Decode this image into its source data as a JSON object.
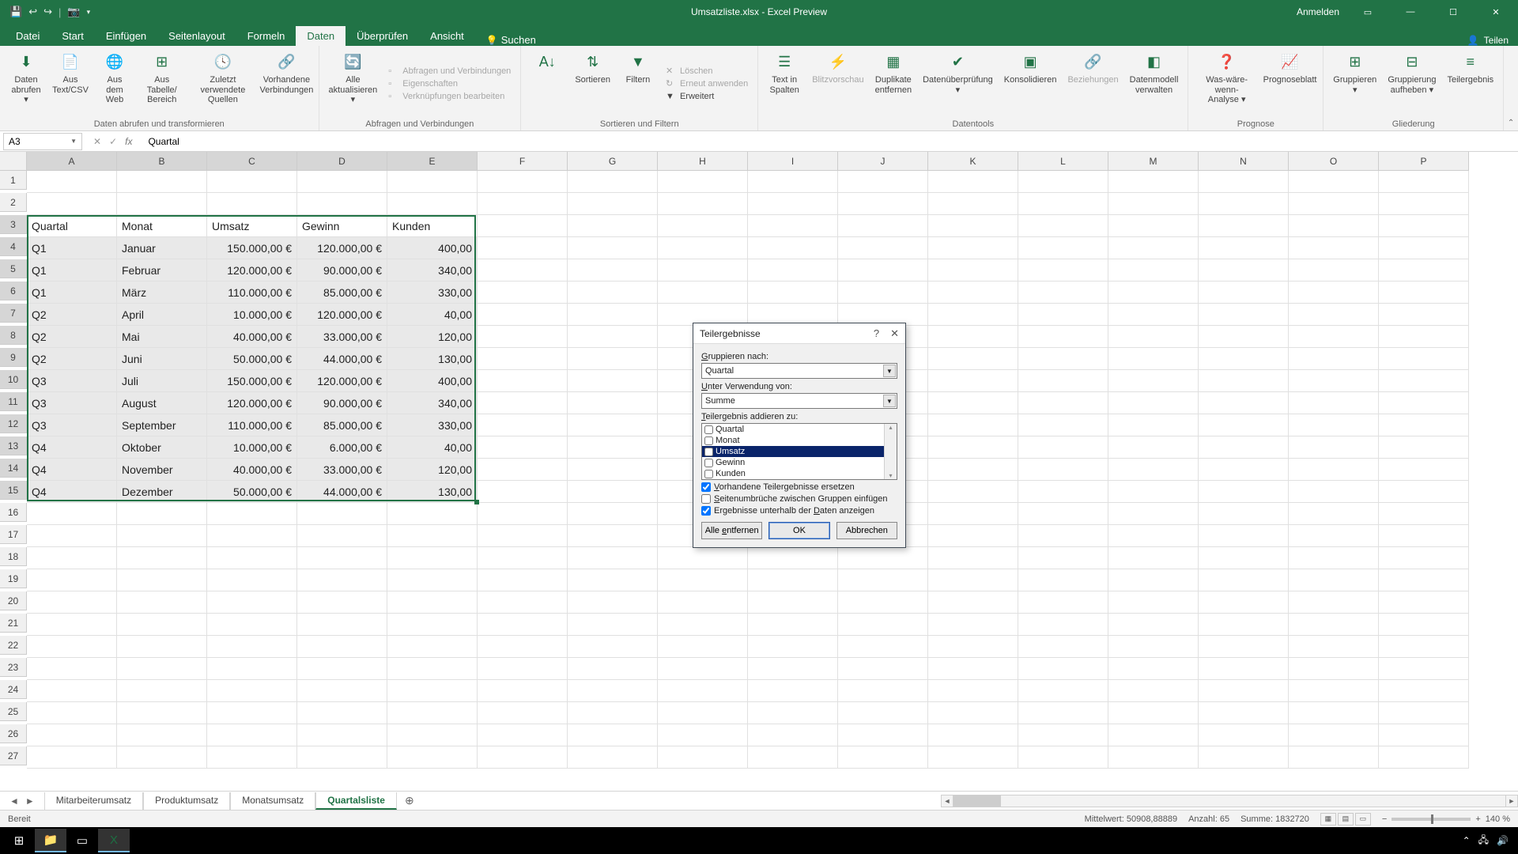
{
  "titlebar": {
    "title": "Umsatzliste.xlsx - Excel Preview",
    "anmelden": "Anmelden"
  },
  "menu": {
    "tabs": [
      "Datei",
      "Start",
      "Einfügen",
      "Seitenlayout",
      "Formeln",
      "Daten",
      "Überprüfen",
      "Ansicht"
    ],
    "active": 5,
    "search": "Suchen",
    "share": "Teilen"
  },
  "ribbon": {
    "g1": {
      "items": [
        "Daten\nabrufen ▾",
        "Aus\nText/CSV",
        "Aus dem\nWeb",
        "Aus Tabelle/\nBereich",
        "Zuletzt verwendete\nQuellen",
        "Vorhandene\nVerbindungen"
      ],
      "label": "Daten abrufen und transformieren"
    },
    "g2": {
      "btn": "Alle\naktualisieren ▾",
      "list": [
        "Abfragen und Verbindungen",
        "Eigenschaften",
        "Verknüpfungen bearbeiten"
      ],
      "label": "Abfragen und Verbindungen"
    },
    "g3": {
      "items": [
        "Sortieren",
        "Filtern"
      ],
      "list": [
        "Löschen",
        "Erneut anwenden",
        "Erweitert"
      ],
      "label": "Sortieren und Filtern"
    },
    "g4": {
      "items": [
        "Text in\nSpalten",
        "Blitzvorschau",
        "Duplikate\nentfernen",
        "Datenüberprüfung\n▾",
        "Konsolidieren",
        "Beziehungen",
        "Datenmodell\nverwalten"
      ],
      "label": "Datentools"
    },
    "g5": {
      "items": [
        "Was-wäre-wenn-\nAnalyse ▾",
        "Prognoseblatt"
      ],
      "label": "Prognose"
    },
    "g6": {
      "items": [
        "Gruppieren\n▾",
        "Gruppierung\naufheben ▾",
        "Teilergebnis"
      ],
      "label": "Gliederung"
    }
  },
  "namebox": "A3",
  "formula": "Quartal",
  "columns": [
    "A",
    "B",
    "C",
    "D",
    "E",
    "F",
    "G",
    "H",
    "I",
    "J",
    "K",
    "L",
    "M",
    "N",
    "O",
    "P"
  ],
  "rows": [
    1,
    2,
    3,
    4,
    5,
    6,
    7,
    8,
    9,
    10,
    11,
    12,
    13,
    14,
    15,
    16,
    17,
    18,
    19,
    20,
    21,
    22,
    23,
    24,
    25,
    26,
    27
  ],
  "headers": [
    "Quartal",
    "Monat",
    "Umsatz",
    "Gewinn",
    "Kunden"
  ],
  "data": [
    [
      "Q1",
      "Januar",
      "150.000,00 €",
      "120.000,00 €",
      "400,00"
    ],
    [
      "Q1",
      "Februar",
      "120.000,00 €",
      "90.000,00 €",
      "340,00"
    ],
    [
      "Q1",
      "März",
      "110.000,00 €",
      "85.000,00 €",
      "330,00"
    ],
    [
      "Q2",
      "April",
      "10.000,00 €",
      "120.000,00 €",
      "40,00"
    ],
    [
      "Q2",
      "Mai",
      "40.000,00 €",
      "33.000,00 €",
      "120,00"
    ],
    [
      "Q2",
      "Juni",
      "50.000,00 €",
      "44.000,00 €",
      "130,00"
    ],
    [
      "Q3",
      "Juli",
      "150.000,00 €",
      "120.000,00 €",
      "400,00"
    ],
    [
      "Q3",
      "August",
      "120.000,00 €",
      "90.000,00 €",
      "340,00"
    ],
    [
      "Q3",
      "September",
      "110.000,00 €",
      "85.000,00 €",
      "330,00"
    ],
    [
      "Q4",
      "Oktober",
      "10.000,00 €",
      "6.000,00 €",
      "40,00"
    ],
    [
      "Q4",
      "November",
      "40.000,00 €",
      "33.000,00 €",
      "120,00"
    ],
    [
      "Q4",
      "Dezember",
      "50.000,00 €",
      "44.000,00 €",
      "130,00"
    ]
  ],
  "dialog": {
    "title": "Teilergebnisse",
    "group_label": "Gruppieren nach:",
    "group_value": "Quartal",
    "func_label": "Unter Verwendung von:",
    "func_value": "Summe",
    "add_label": "Teilergebnis addieren zu:",
    "fields": [
      "Quartal",
      "Monat",
      "Umsatz",
      "Gewinn",
      "Kunden"
    ],
    "chk1": "Vorhandene Teilergebnisse ersetzen",
    "chk2": "Seitenumbrüche zwischen Gruppen einfügen",
    "chk3": "Ergebnisse unterhalb der Daten anzeigen",
    "btn_removeall": "Alle entfernen",
    "btn_ok": "OK",
    "btn_cancel": "Abbrechen"
  },
  "sheets": [
    "Mitarbeiterumsatz",
    "Produktumsatz",
    "Monatsumsatz",
    "Quartalsliste"
  ],
  "active_sheet": 3,
  "status": {
    "ready": "Bereit",
    "avg": "Mittelwert: 50908,88889",
    "count": "Anzahl: 65",
    "sum": "Summe: 1832720",
    "zoom": "140 %"
  }
}
